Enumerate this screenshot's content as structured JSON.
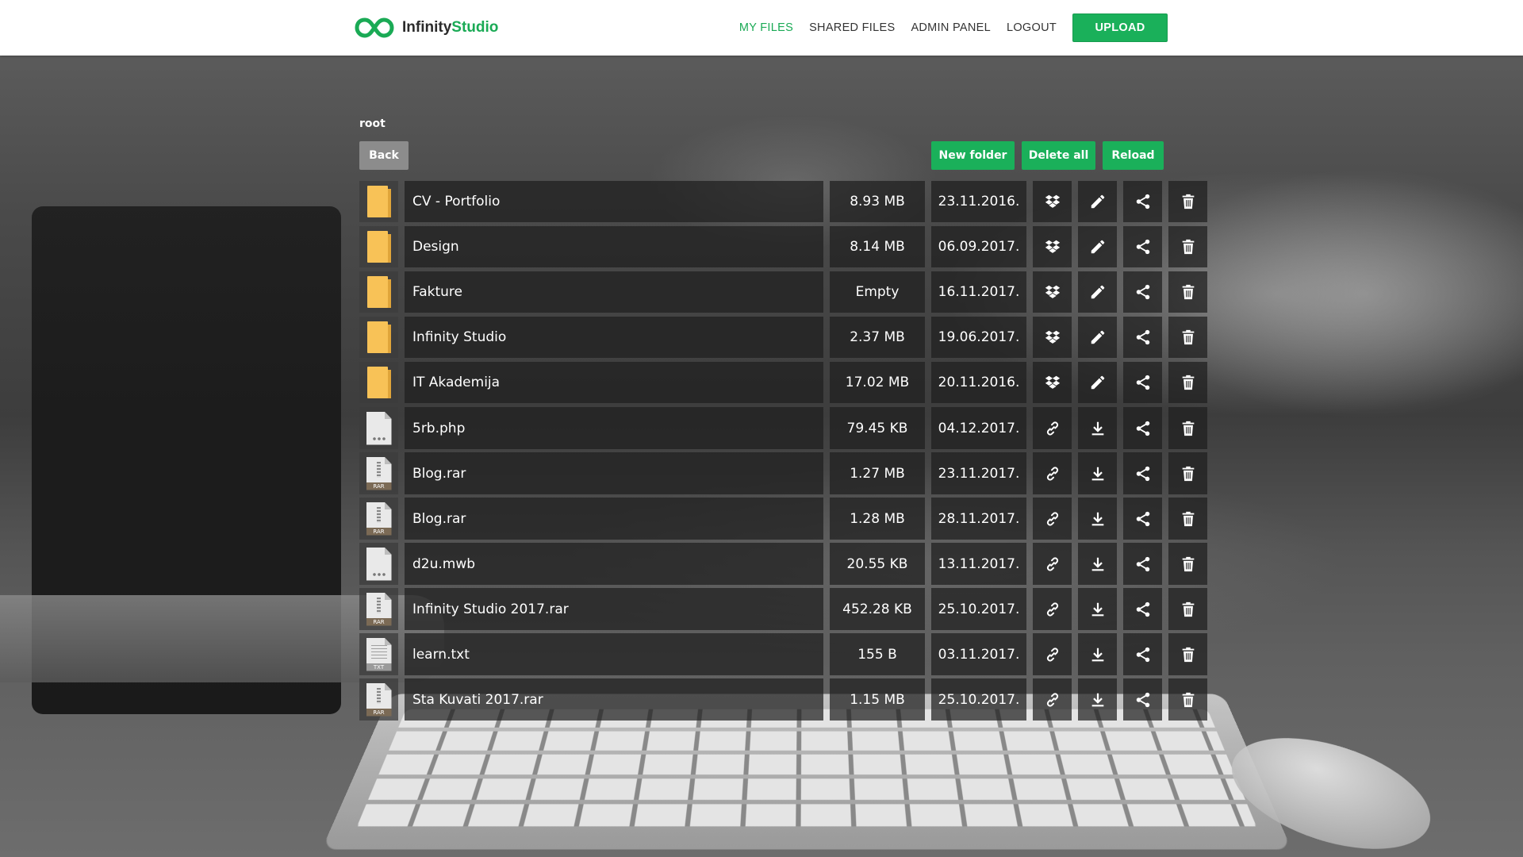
{
  "header": {
    "brand_part1": "Infinity",
    "brand_part2": "Studio",
    "nav": {
      "my_files": "MY FILES",
      "shared_files": "SHARED FILES",
      "admin_panel": "ADMIN PANEL",
      "logout": "LOGOUT",
      "upload": "UPLOAD"
    }
  },
  "breadcrumb": "root",
  "toolbar": {
    "back": "Back",
    "new_folder": "New folder",
    "delete_all": "Delete all",
    "reload": "Reload"
  },
  "colors": {
    "accent": "#1aaa55",
    "button_green": "#1ab05a",
    "button_gray": "#8c8c8c",
    "folder": "#f8c257"
  },
  "rows": [
    {
      "type": "folder",
      "name": "CV - Portfolio",
      "size": "8.93 MB",
      "date": "23.11.2016.",
      "actions": [
        "dropbox-icon",
        "pencil-icon",
        "share-icon",
        "trash-icon"
      ]
    },
    {
      "type": "folder",
      "name": "Design",
      "size": "8.14 MB",
      "date": "06.09.2017.",
      "actions": [
        "dropbox-icon",
        "pencil-icon",
        "share-icon",
        "trash-icon"
      ]
    },
    {
      "type": "folder",
      "name": "Fakture",
      "size": "Empty",
      "date": "16.11.2017.",
      "actions": [
        "dropbox-icon",
        "pencil-icon",
        "share-icon",
        "trash-icon"
      ]
    },
    {
      "type": "folder",
      "name": "Infinity Studio",
      "size": "2.37 MB",
      "date": "19.06.2017.",
      "actions": [
        "dropbox-icon",
        "pencil-icon",
        "share-icon",
        "trash-icon"
      ]
    },
    {
      "type": "folder",
      "name": "IT Akademija",
      "size": "17.02 MB",
      "date": "20.11.2016.",
      "actions": [
        "dropbox-icon",
        "pencil-icon",
        "share-icon",
        "trash-icon"
      ]
    },
    {
      "type": "generic",
      "name": "5rb.php",
      "size": "79.45 KB",
      "date": "04.12.2017.",
      "actions": [
        "link-icon",
        "download-icon",
        "share-icon",
        "trash-icon"
      ]
    },
    {
      "type": "rar",
      "tag": "RAR",
      "name": "Blog.rar",
      "size": "1.27 MB",
      "date": "23.11.2017.",
      "actions": [
        "link-icon",
        "download-icon",
        "share-icon",
        "trash-icon"
      ]
    },
    {
      "type": "rar",
      "tag": "RAR",
      "name": "Blog.rar",
      "size": "1.28 MB",
      "date": "28.11.2017.",
      "actions": [
        "link-icon",
        "download-icon",
        "share-icon",
        "trash-icon"
      ]
    },
    {
      "type": "generic",
      "name": "d2u.mwb",
      "size": "20.55 KB",
      "date": "13.11.2017.",
      "actions": [
        "link-icon",
        "download-icon",
        "share-icon",
        "trash-icon"
      ]
    },
    {
      "type": "rar",
      "tag": "RAR",
      "name": "Infinity Studio 2017.rar",
      "size": "452.28 KB",
      "date": "25.10.2017.",
      "actions": [
        "link-icon",
        "download-icon",
        "share-icon",
        "trash-icon"
      ]
    },
    {
      "type": "txt",
      "tag": "TXT",
      "name": "learn.txt",
      "size": "155 B",
      "date": "03.11.2017.",
      "actions": [
        "link-icon",
        "download-icon",
        "share-icon",
        "trash-icon"
      ]
    },
    {
      "type": "rar",
      "tag": "RAR",
      "name": "Sta Kuvati 2017.rar",
      "size": "1.15 MB",
      "date": "25.10.2017.",
      "actions": [
        "link-icon",
        "download-icon",
        "share-icon",
        "trash-icon"
      ]
    }
  ]
}
